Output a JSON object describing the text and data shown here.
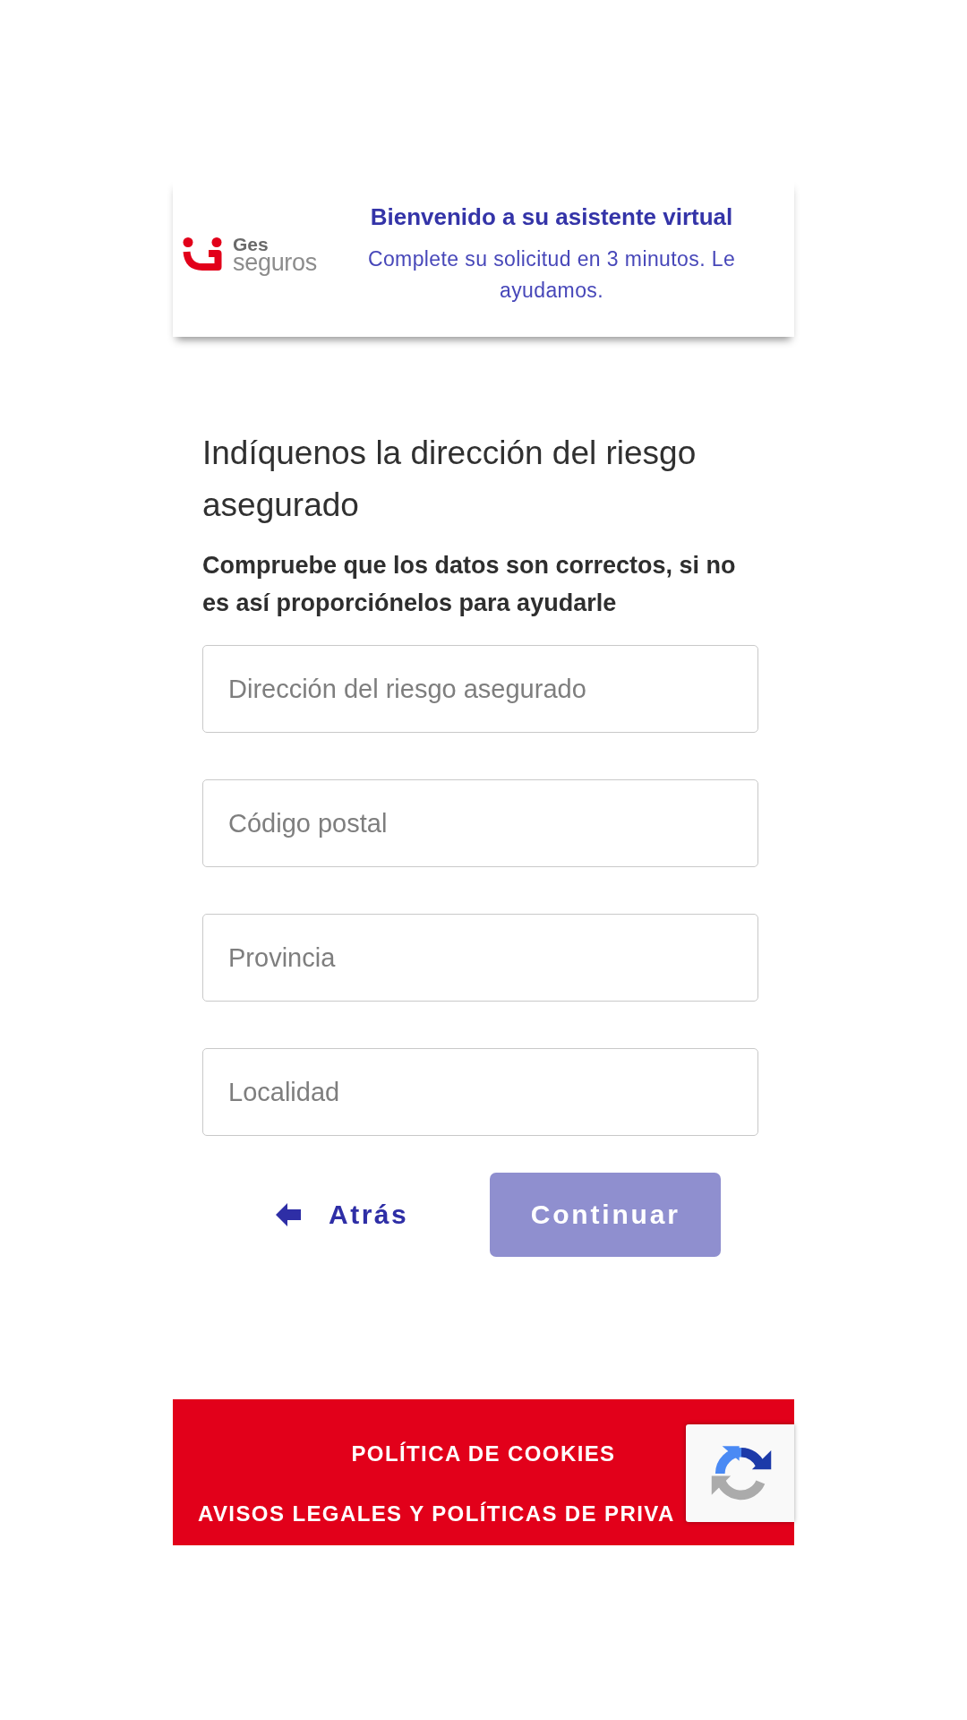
{
  "header": {
    "logo": {
      "top_word": "Ges",
      "bottom_word": "seguros"
    },
    "title": "Bienvenido a su asistente virtual",
    "subtitle": "Complete su solicitud en 3 minutos. Le ayudamos."
  },
  "form": {
    "title": "Indíquenos la dirección del riesgo asegurado",
    "instructions": "Compruebe que los datos son correctos, si no es así proporciónelos para ayudarle",
    "fields": [
      {
        "placeholder": "Dirección del riesgo asegurado"
      },
      {
        "placeholder": "Código postal"
      },
      {
        "placeholder": "Provincia"
      },
      {
        "placeholder": "Localidad"
      }
    ]
  },
  "actions": {
    "back": {
      "label": "Atrás"
    },
    "continue": {
      "label": "Continuar",
      "disabled": true
    }
  },
  "footer": {
    "links": [
      "POLÍTICA DE COOKIES",
      "AVISOS LEGALES Y POLÍTICAS DE PRIVA"
    ]
  }
}
